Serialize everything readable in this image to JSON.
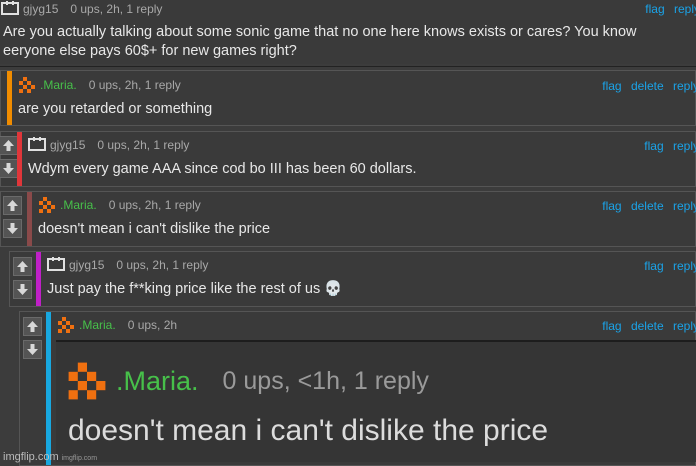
{
  "watermark": {
    "main": "imgflip.com",
    "small": "imgflip.com"
  },
  "actions": {
    "flag": "flag",
    "delete": "delete",
    "reply": "reply"
  },
  "comments": [
    {
      "user": "gjyg15",
      "meta": "0 ups, 2h, 1 reply",
      "text": "Are you actually talking about some sonic game that no one here knows exists or cares? You know eeryone else pays 60$+ for new games right?"
    },
    {
      "user": ".Maria.",
      "meta": "0 ups, 2h, 1 reply",
      "text": "are you retarded or something"
    },
    {
      "user": "gjyg15",
      "meta": "0 ups, 2h, 1 reply",
      "text": "Wdym every game AAA since cod bo III has been 60 dollars."
    },
    {
      "user": ".Maria.",
      "meta": "0 ups, 2h, 1 reply",
      "text": "doesn't mean i can't dislike the price"
    },
    {
      "user": "gjyg15",
      "meta": "0 ups, 2h, 1 reply",
      "text": "Just pay the f**king price like the rest of us 💀"
    },
    {
      "user": ".Maria.",
      "meta": "0 ups, 2h",
      "text": ""
    }
  ],
  "embedded": {
    "user": ".Maria.",
    "meta": "0 ups, <1h, 1 reply",
    "text": "doesn't mean i can't dislike the price"
  },
  "colors": {
    "orange": "#f08c00",
    "red": "#e0363a",
    "brown": "#8a4a4a",
    "magenta": "#c020c8",
    "cyan": "#18a8e0",
    "link": "#1aa3e8",
    "green": "#47c04a"
  }
}
